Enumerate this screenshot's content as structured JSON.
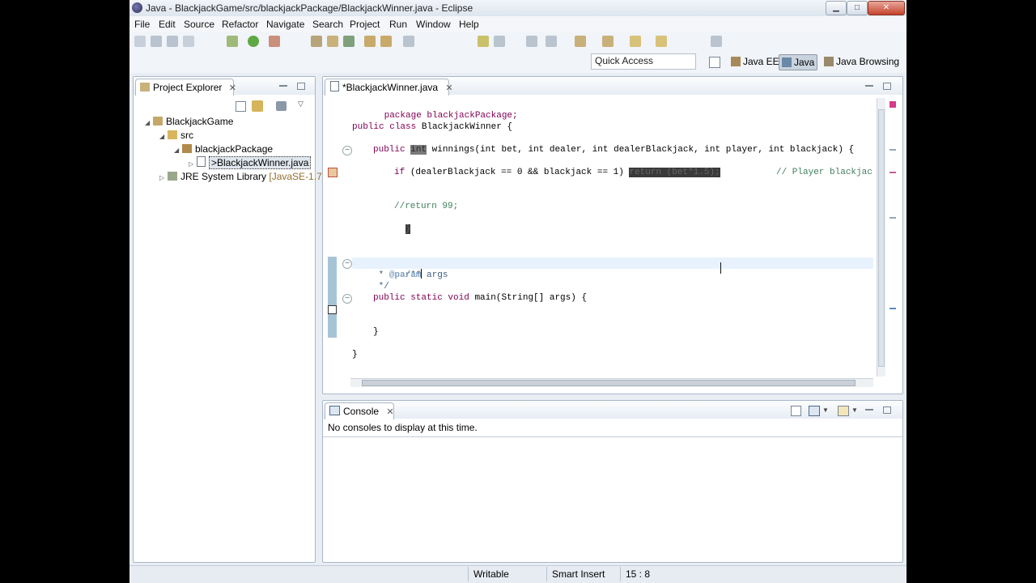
{
  "window": {
    "title": "Java - BlackjackGame/src/blackjackPackage/BlackjackWinner.java - Eclipse",
    "controls": {
      "minimize": "▁",
      "maximize": "□",
      "close": "✕"
    }
  },
  "menu": [
    "File",
    "Edit",
    "Source",
    "Refactor",
    "Navigate",
    "Search",
    "Project",
    "Run",
    "Window",
    "Help"
  ],
  "quick_access": {
    "value": "Quick Access"
  },
  "perspectives": [
    {
      "label": "Java EE",
      "icon": "java-ee-perspective-icon"
    },
    {
      "label": "Java",
      "icon": "java-perspective-icon",
      "active": true
    },
    {
      "label": "Java Browsing",
      "icon": "java-browsing-perspective-icon"
    }
  ],
  "project_explorer": {
    "tab_label": "Project Explorer",
    "tree": [
      {
        "label": "BlackjackGame",
        "icon": "project-icon",
        "level": 0,
        "expanded": true
      },
      {
        "label": "src",
        "icon": "source-folder-icon",
        "level": 1,
        "expanded": true
      },
      {
        "label": "blackjackPackage",
        "icon": "package-icon",
        "level": 2,
        "expanded": true
      },
      {
        "label": ">BlackjackWinner.java",
        "icon": "java-file-icon",
        "level": 3,
        "selected": true
      },
      {
        "label": "JRE System Library",
        "suffix": "[JavaSE-1.7]",
        "icon": "library-icon",
        "level": 1,
        "expanded": false
      }
    ]
  },
  "editor": {
    "tab_label": "*BlackjackWinner.java",
    "code": {
      "l1": "package blackjackPackage;",
      "l2_kw1": "public",
      "l2_kw2": "class",
      "l2_rest": "BlackjackWinner {",
      "l3_kw": "public",
      "l3_type": "int",
      "l3_sig": "winnings(",
      "l3_params": "int bet, int dealer, int dealerBlackjack, int player, int blackjack) {",
      "l4_kw": "if",
      "l4_cond": "(dealerBlackjack == 0 && blackjack == 1)",
      "l4_hl": "return (bet*1.5);",
      "l4_comment": "// Player blackjack",
      "l5_comment": "//return 99;",
      "l6_brace": "}",
      "l7": "/**",
      "l8_star": " * ",
      "l8_tag": "@param",
      "l8_rest": " args",
      "l9": " */",
      "l10_kw": "public static void",
      "l10_rest": "main(String[] args) {",
      "l11": "}",
      "l12": "}"
    }
  },
  "console": {
    "tab_label": "Console",
    "message": "No consoles to display at this time."
  },
  "status_bar": {
    "writable": "Writable",
    "insert_mode": "Smart Insert",
    "position": "15 : 8"
  },
  "colors": {
    "keyword": "#7f0055",
    "comment": "#3f7f5f",
    "javadoc": "#3f5f7f",
    "selection": "#3a3a3a"
  }
}
